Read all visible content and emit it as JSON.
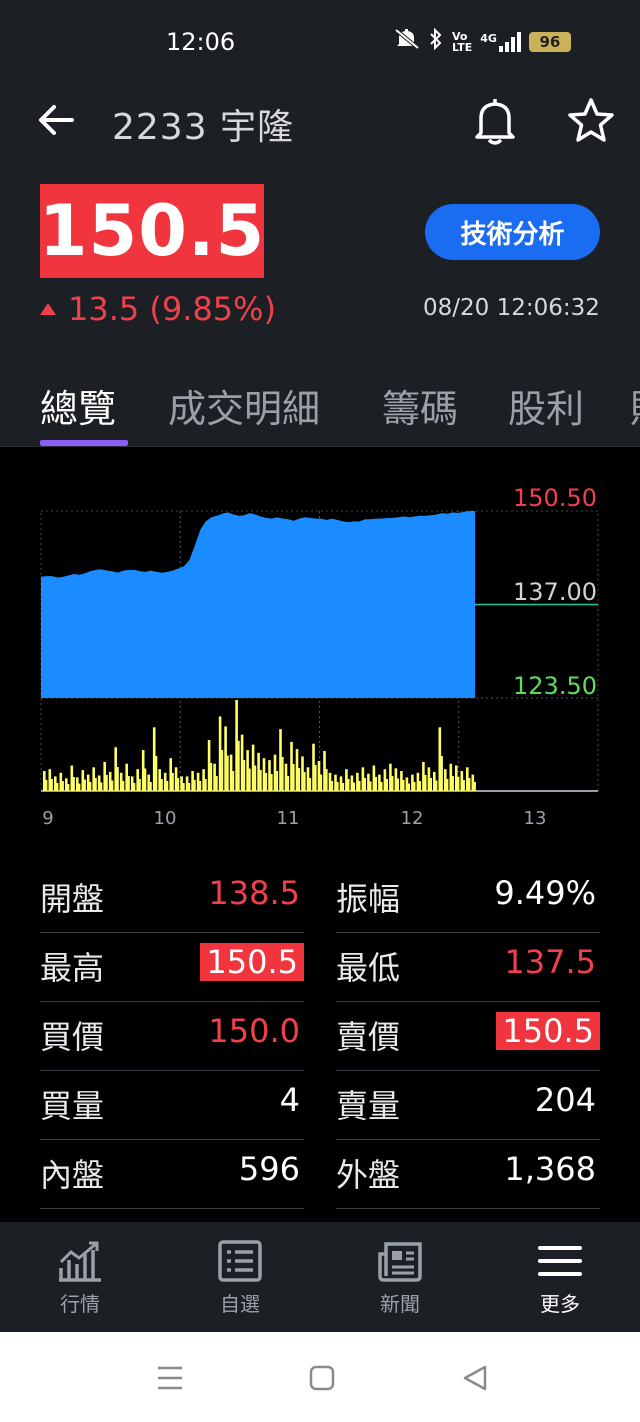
{
  "status_bar": {
    "time": "12:06",
    "battery": "96",
    "network": "4G"
  },
  "header": {
    "title": "2233 宇隆"
  },
  "quote": {
    "price": "150.5",
    "change": "13.5 (9.85%)",
    "timestamp": "08/20 12:06:32",
    "tech_button": "技術分析"
  },
  "tabs": [
    {
      "label": "總覽",
      "active": true
    },
    {
      "label": "成交明細",
      "active": false
    },
    {
      "label": "籌碼",
      "active": false
    },
    {
      "label": "股利",
      "active": false
    },
    {
      "label": "財",
      "active": false
    }
  ],
  "chart_data": {
    "type": "area",
    "price_labels": {
      "high": "150.50",
      "mid": "137.00",
      "low": "123.50"
    },
    "ylim": [
      123.5,
      150.5
    ],
    "x_ticks": [
      "9",
      "10",
      "11",
      "12",
      "13"
    ],
    "colors": {
      "area": "#1a8cff",
      "volume": "#ffff66",
      "ref_line": "#1dc7a0",
      "high_label": "#f0404c",
      "mid_label": "#cfd2d6",
      "low_label": "#5fdc5f"
    },
    "price_series": [
      141.0,
      141.1,
      141.1,
      140.9,
      141.0,
      141.2,
      141.4,
      141.3,
      141.5,
      141.8,
      142.0,
      142.1,
      141.9,
      141.8,
      141.6,
      141.9,
      142.0,
      142.0,
      141.8,
      141.7,
      141.9,
      141.7,
      141.6,
      141.7,
      141.9,
      142.2,
      142.5,
      143.4,
      145.5,
      147.8,
      149.0,
      149.6,
      149.8,
      150.1,
      150.3,
      150.0,
      149.8,
      149.9,
      150.2,
      150.0,
      149.7,
      149.5,
      149.4,
      149.6,
      149.4,
      149.3,
      149.1,
      149.4,
      149.6,
      149.5,
      149.4,
      149.4,
      149.2,
      149.4,
      149.2,
      149.0,
      148.9,
      149.0,
      149.0,
      149.3,
      149.3,
      149.4,
      149.4,
      149.5,
      149.5,
      149.6,
      149.7,
      149.6,
      149.7,
      149.8,
      149.8,
      149.9,
      150.0,
      150.2,
      150.1,
      150.3,
      150.2,
      150.4,
      150.5
    ],
    "volume_series": [
      2.2,
      2.4,
      1.6,
      2.0,
      1.4,
      2.8,
      1.5,
      2.3,
      1.8,
      2.6,
      1.7,
      3.2,
      2.1,
      4.8,
      2.0,
      3.0,
      1.6,
      2.4,
      4.5,
      1.8,
      7.0,
      2.4,
      2.0,
      3.6,
      2.6,
      1.6,
      1.6,
      2.2,
      2.0,
      2.4,
      5.6,
      3.0,
      8.2,
      7.1,
      4.0,
      10.0,
      6.2,
      4.5,
      5.1,
      4.2,
      3.6,
      3.4,
      4.0,
      6.8,
      3.0,
      5.4,
      4.6,
      3.8,
      2.6,
      5.2,
      3.3,
      4.4,
      2.0,
      1.8,
      1.6,
      2.4,
      1.7,
      2.0,
      2.6,
      1.9,
      2.8,
      1.8,
      2.4,
      3.0,
      2.5,
      2.2,
      1.5,
      1.8,
      2.0,
      3.2,
      2.6,
      2.1,
      7.0,
      2.4,
      3.0,
      2.8,
      2.2,
      2.6,
      1.8
    ]
  },
  "stats": {
    "left": [
      {
        "label": "開盤",
        "value": "138.5",
        "style": "red"
      },
      {
        "label": "最高",
        "value": "150.5",
        "style": "badge"
      },
      {
        "label": "買價",
        "value": "150.0",
        "style": "red"
      },
      {
        "label": "買量",
        "value": "4",
        "style": "white"
      },
      {
        "label": "內盤",
        "value": "596",
        "style": "white"
      }
    ],
    "right": [
      {
        "label": "振幅",
        "value": "9.49%",
        "style": "white"
      },
      {
        "label": "最低",
        "value": "137.5",
        "style": "red"
      },
      {
        "label": "賣價",
        "value": "150.5",
        "style": "badge"
      },
      {
        "label": "賣量",
        "value": "204",
        "style": "white"
      },
      {
        "label": "外盤",
        "value": "1,368",
        "style": "white"
      }
    ]
  },
  "bottom_nav": [
    {
      "label": "行情",
      "icon": "chart-icon",
      "active": false
    },
    {
      "label": "自選",
      "icon": "list-icon",
      "active": false
    },
    {
      "label": "新聞",
      "icon": "news-icon",
      "active": false
    },
    {
      "label": "更多",
      "icon": "menu-icon",
      "active": true
    }
  ]
}
